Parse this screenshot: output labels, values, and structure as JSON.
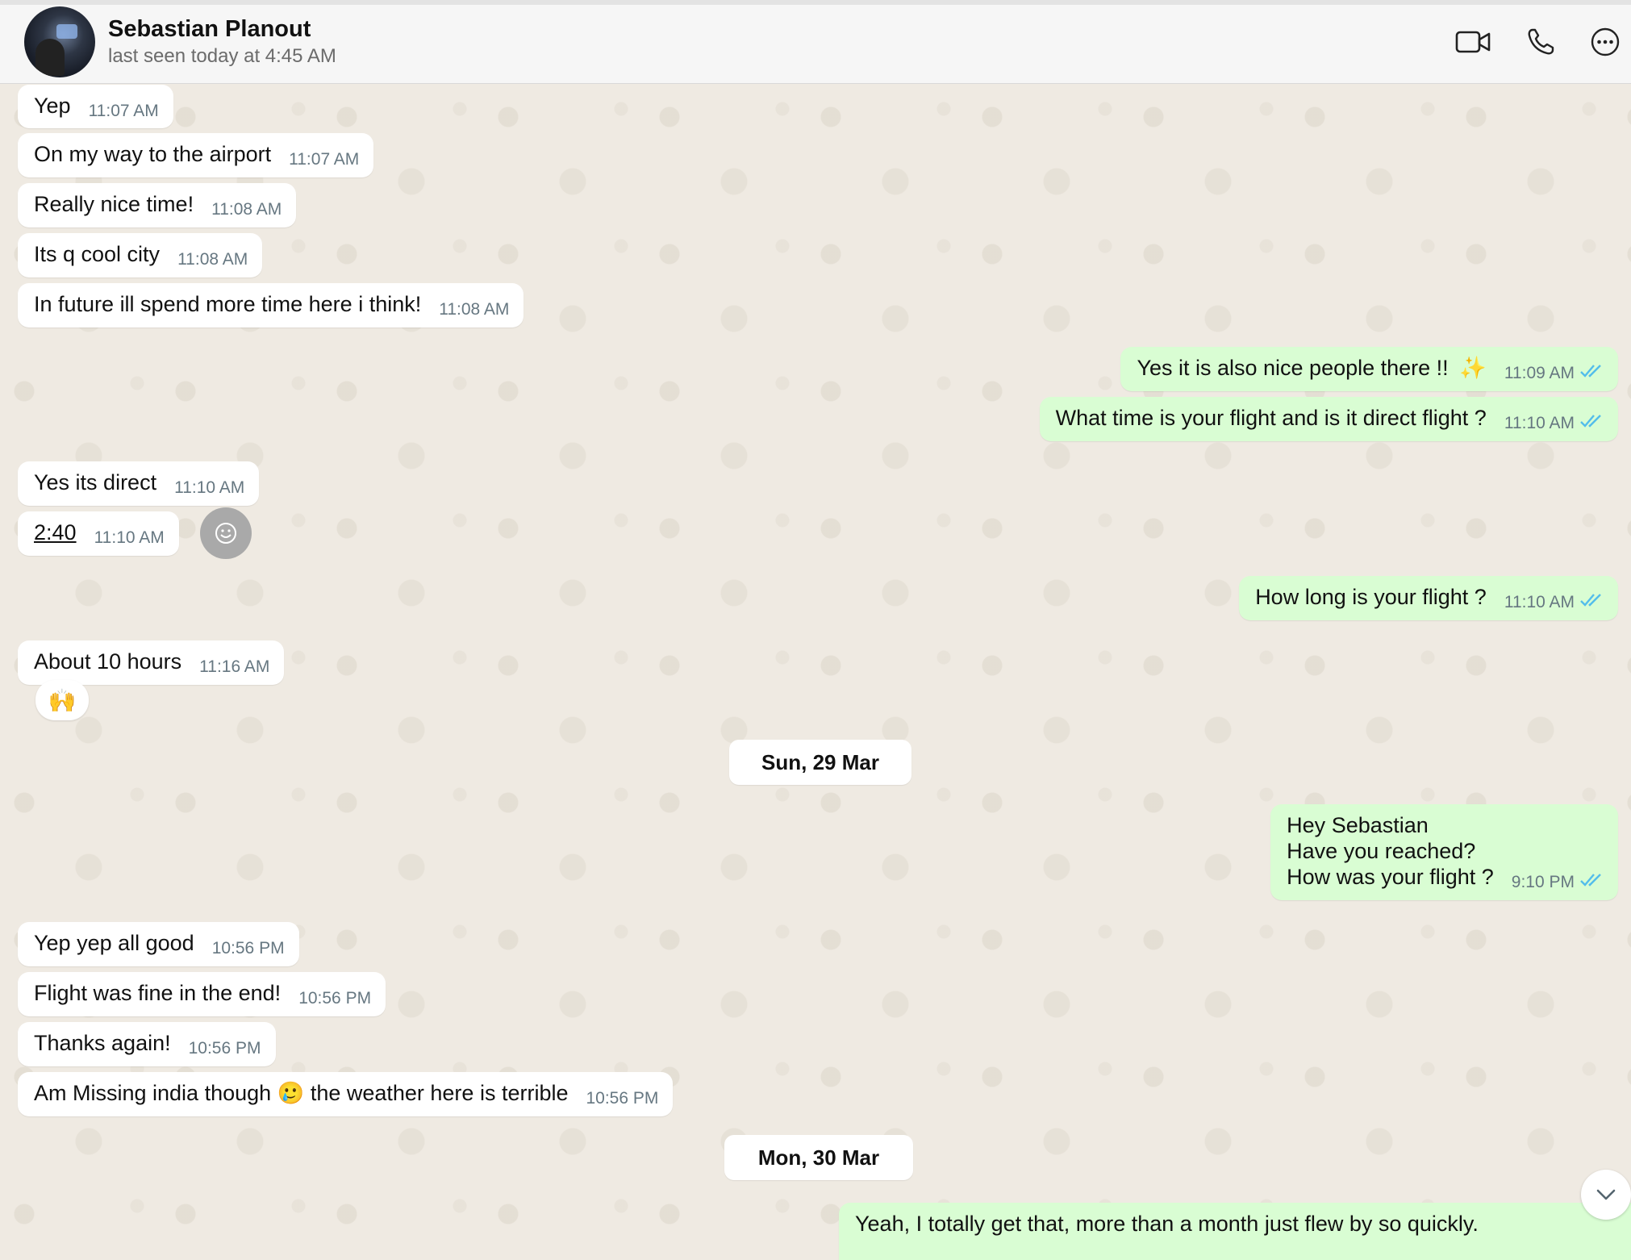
{
  "header": {
    "contact_name": "Sebastian Planout",
    "last_seen": "last seen today at 4:45 AM"
  },
  "messages": [
    {
      "dir": "in",
      "text": "Yep",
      "time": "11:07 AM"
    },
    {
      "dir": "in",
      "text": "On my way to the airport",
      "time": "11:07 AM"
    },
    {
      "dir": "in",
      "text": "Really nice time!",
      "time": "11:08 AM"
    },
    {
      "dir": "in",
      "text": "Its q cool city",
      "time": "11:08 AM"
    },
    {
      "dir": "in",
      "text": "In future ill spend more time here i think!",
      "time": "11:08 AM"
    },
    {
      "dir": "out",
      "text": "Yes it is also nice people there !!",
      "emoji": "✨",
      "time": "11:09 AM"
    },
    {
      "dir": "out",
      "text": "What time is your flight and is it direct flight ?",
      "time": "11:10 AM"
    },
    {
      "dir": "in",
      "text": "Yes its direct",
      "time": "11:10 AM"
    },
    {
      "dir": "in",
      "text": "2:40",
      "time": "11:10 AM"
    },
    {
      "dir": "out",
      "text": "How long is your flight ?",
      "time": "11:10 AM"
    },
    {
      "dir": "in",
      "text": "About 10 hours",
      "time": "11:16 AM",
      "reaction": "🙌"
    },
    {
      "dir": "out",
      "lines": [
        "Hey Sebastian",
        "Have you reached?",
        "How was your flight ?"
      ],
      "time": "9:10 PM"
    },
    {
      "dir": "in",
      "text": "Yep yep all good",
      "time": "10:56 PM"
    },
    {
      "dir": "in",
      "text": "Flight was fine in the end!",
      "time": "10:56 PM"
    },
    {
      "dir": "in",
      "text": "Thanks again!",
      "time": "10:56 PM"
    },
    {
      "dir": "in",
      "text_before": "Am Missing india though",
      "emoji": "🥲",
      "text_after": "the weather here is terrible",
      "time": "10:56 PM"
    },
    {
      "dir": "out",
      "text": "Yeah, I totally get that, more than a month just flew by so quickly."
    }
  ],
  "date_separators": [
    "Sun, 29 Mar",
    "Mon, 30 Mar"
  ],
  "icons": {
    "video": "video-call-icon",
    "voice": "voice-call-icon",
    "more": "more-options-icon",
    "react": "add-reaction-icon",
    "scroll": "scroll-down-icon",
    "read": "double-check-icon"
  },
  "colors": {
    "incoming_bubble": "#ffffff",
    "outgoing_bubble": "#d9fdd3",
    "read_ticks": "#53bdeb",
    "chat_background": "#efeae2"
  }
}
